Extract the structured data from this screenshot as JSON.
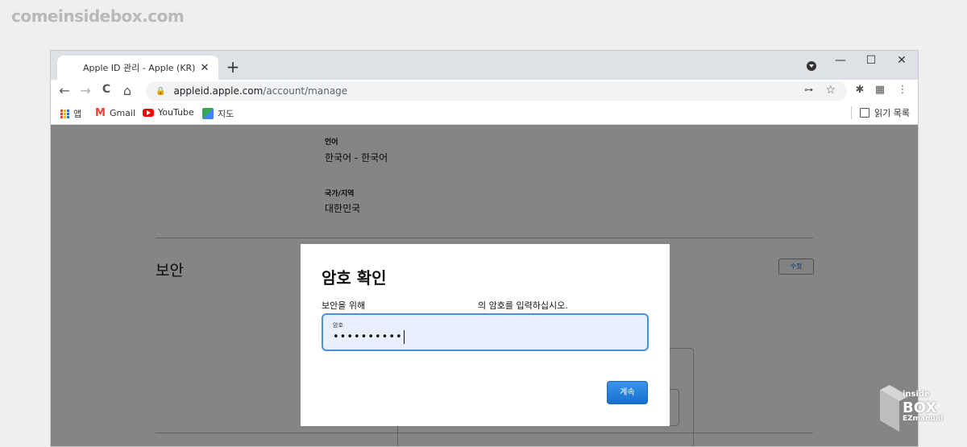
{
  "watermark": "comeinsidebox.com",
  "tab": {
    "title": "Apple ID 관리 - Apple (KR)",
    "close": "✕",
    "new": "+"
  },
  "window": {
    "minimize": "—",
    "maximize": "☐",
    "close": "✕"
  },
  "toolbar": {
    "back": "←",
    "forward": "→",
    "reload": "C",
    "home": "⌂",
    "url_host": "appleid.apple.com",
    "url_path": "/account/manage",
    "key": "⊶",
    "star": "☆",
    "extensions": "✱",
    "ext2": "▦",
    "menu": "⋮"
  },
  "bookmarks": {
    "apps": "앱",
    "gmail_icon": "M",
    "gmail": "Gmail",
    "youtube": "YouTube",
    "maps": "지도",
    "reading_list": "읽기 목록"
  },
  "page": {
    "language_label": "언어",
    "language_value": "한국어 - 한국어",
    "region_label": "국가/지역",
    "region_value": "대한민국",
    "security_title": "보안",
    "edit_button": "수정"
  },
  "modal": {
    "title": "암호 확인",
    "description_prefix": "보안을 위해",
    "description_suffix": "의 암호를 입력하십시오.",
    "password_label": "암호",
    "password_value": "••••••••••",
    "continue_button": "계속"
  },
  "logo": {
    "top": "inside",
    "main": "BOX",
    "sub": "EZmanual"
  }
}
